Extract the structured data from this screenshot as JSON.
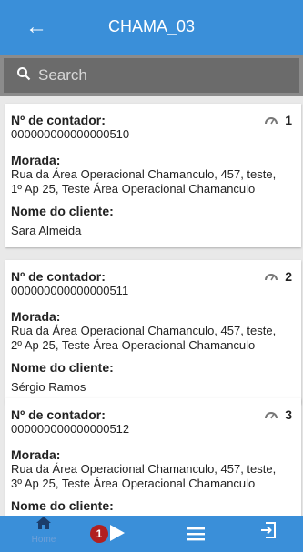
{
  "header": {
    "title": "CHAMA_03",
    "back_icon": "arrow-left-icon"
  },
  "search": {
    "placeholder": "Search"
  },
  "labels": {
    "meter_no": "Nº de contador:",
    "address": "Morada:",
    "client_name": "Nome do cliente:"
  },
  "cards": [
    {
      "index": "1",
      "meter": "000000000000000510",
      "address_l1": "Rua da Área Operacional Chamanculo, 457, teste,",
      "address_l2": "1º Ap 25, Teste Área Operacional Chamanculo",
      "client": "Sara Almeida"
    },
    {
      "index": "2",
      "meter": "000000000000000511",
      "address_l1": "Rua da Área Operacional Chamanculo, 457, teste,",
      "address_l2": "2º Ap 25, Teste Área Operacional Chamanculo",
      "client": "Sérgio Ramos"
    },
    {
      "index": "3",
      "meter": "000000000000000512",
      "address_l1": "Rua da Área Operacional Chamanculo, 457, teste,",
      "address_l2": "3º Ap 25, Teste Área Operacional Chamanculo",
      "client": ""
    }
  ],
  "bottom_nav": {
    "home_label": "Home",
    "badge_count": "1",
    "icons": [
      "home-icon",
      "play-icon",
      "menu-icon",
      "exit-icon"
    ]
  },
  "colors": {
    "primary": "#3a8fd9",
    "search_bg": "#6b6b6b",
    "badge": "#b12020"
  }
}
